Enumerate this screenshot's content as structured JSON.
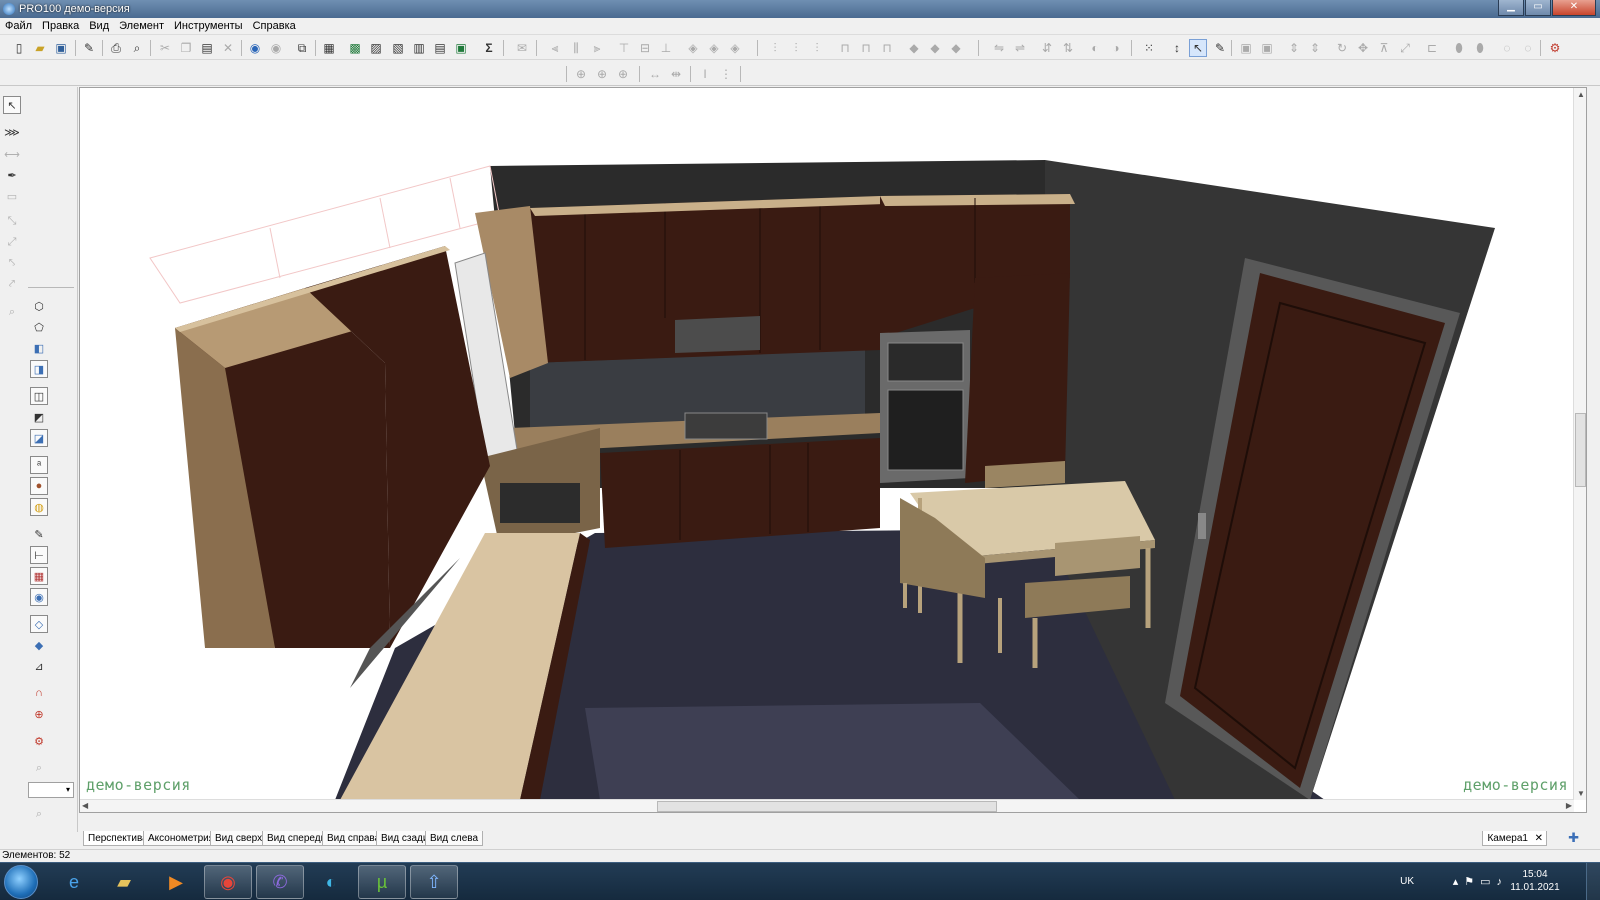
{
  "window": {
    "title": "PRO100 демо-версия",
    "minimize_glyph": "▁",
    "maximize_glyph": "▭",
    "close_glyph": "✕"
  },
  "menu": [
    "Файл",
    "Правка",
    "Вид",
    "Элемент",
    "Инструменты",
    "Справка"
  ],
  "toolbar_icons": [
    "new-file-icon",
    "open-folder-icon",
    "save-icon",
    "edit-properties-icon",
    "print-icon",
    "print-preview-icon",
    "cut-icon",
    "copy-icon",
    "paste-icon",
    "delete-icon",
    "undo-icon",
    "redo-icon",
    "group-icon",
    "catalog-icon",
    "view-settings-icon",
    "render-icon",
    "dimensions-icon",
    "export-icon",
    "report-icon",
    "sum-icon",
    "mail-icon",
    "align-icon",
    "rotate-icon",
    "grid-snap-icon",
    "select-mode-icon",
    "pencil-icon",
    "settings-icon"
  ],
  "palette_icons": [
    "pointer-icon",
    "multi-select-icon",
    "measure-icon",
    "eyedropper-icon",
    "box-icon",
    "move-icon",
    "rotate-icon",
    "copy-icon",
    "stretch-icon",
    "zoom-icon",
    "board-icon",
    "panel-icon",
    "cube-icon",
    "cube-filled-icon",
    "drawer-icon",
    "shelf-icon",
    "cabinet-icon",
    "text-icon",
    "material-icon",
    "light-icon",
    "pen-icon",
    "ruler-icon",
    "grid-icon",
    "eye-icon",
    "diamond-icon",
    "point-icon",
    "scale-icon",
    "magnet-icon",
    "target-icon",
    "gear-icon",
    "zoom-in-icon",
    "zoom-out-icon"
  ],
  "viewport": {
    "watermark_left": "демо-версия",
    "watermark_right": "демо-версия"
  },
  "view_tabs": [
    "Перспектива",
    "Аксонометрия",
    "Вид сверху",
    "Вид спереди",
    "Вид справа",
    "Вид сзади",
    "Вид слева"
  ],
  "camera_tab": "Камера1",
  "status": "Элементов: 52",
  "taskbar": {
    "apps": [
      "internet-explorer-icon",
      "file-explorer-icon",
      "media-player-icon",
      "chrome-icon",
      "viber-icon",
      "edge-icon",
      "utorrent-icon",
      "pro100-icon"
    ],
    "language": "UK",
    "time": "15:04",
    "date": "11.01.2021"
  },
  "colors": {
    "wood_dark": "#3a1d14",
    "wood_light": "#d9c4a2",
    "wall_dark": "#2a2a2a",
    "floor": "#2f3040",
    "watermark": "#5fa06a"
  }
}
